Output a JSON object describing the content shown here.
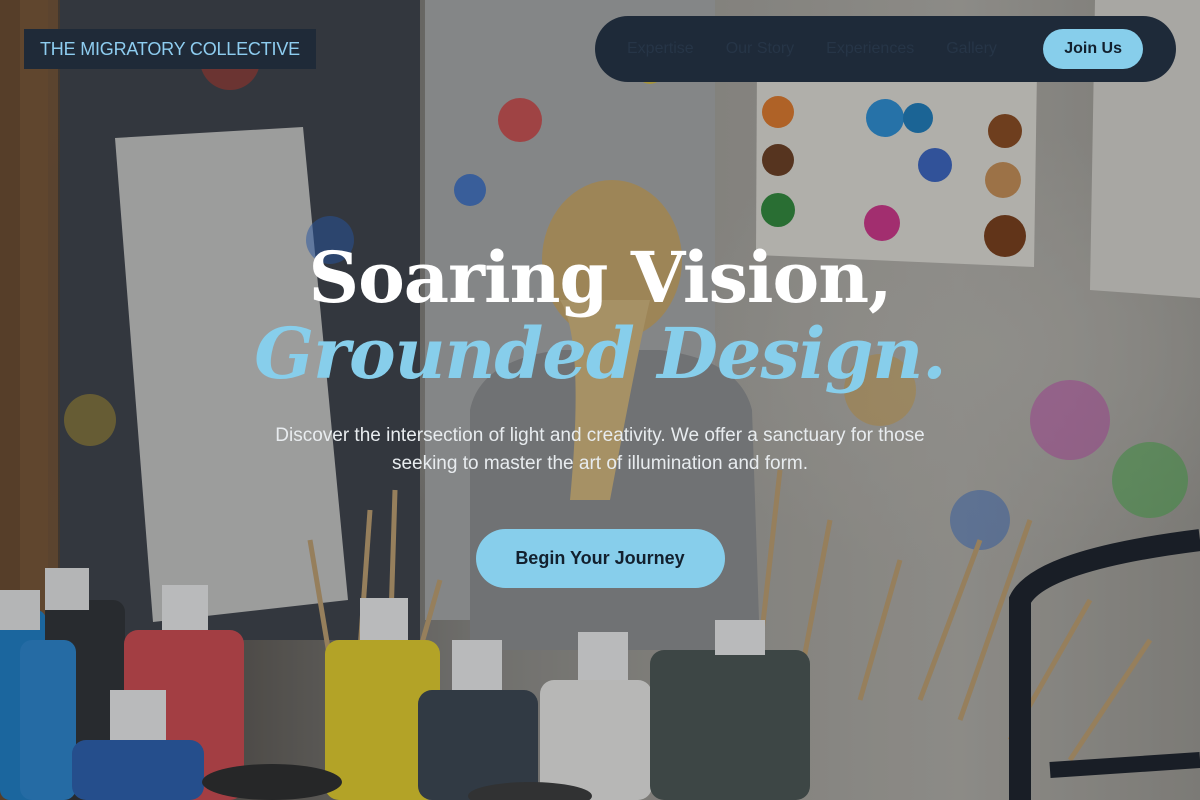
{
  "brand": {
    "name": "THE MIGRATORY COLLECTIVE"
  },
  "nav": {
    "links": [
      "Expertise",
      "Our Story",
      "Experiences",
      "Gallery"
    ],
    "cta": "Join Us"
  },
  "hero": {
    "title_line1": "Soaring Vision,",
    "title_line2": "Grounded Design.",
    "subtitle": "Discover the intersection of light and creativity. We offer a sanctuary for those seeking to master the art of illumination and form.",
    "cta": "Begin Your Journey"
  },
  "colors": {
    "accent": "#87ceeb",
    "nav_background": "#1e2a39",
    "cta_text": "#12202e"
  }
}
